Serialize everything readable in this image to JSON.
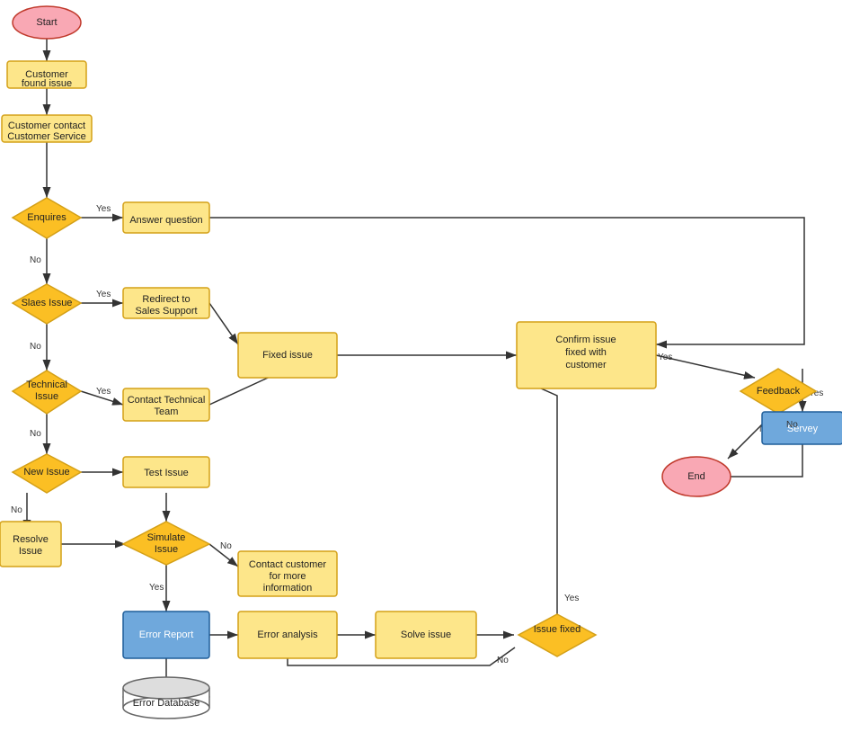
{
  "nodes": {
    "start": "Start",
    "customerFoundIssue": "Customer found issue",
    "customerContactCS": "Customer contact Customer Service",
    "enquires": "Enquires",
    "answerQuestion": "Answer question",
    "slaesIssue": "Slaes Issue",
    "redirectSales": "Redirect to Sales Support",
    "fixedIssue": "Fixed issue",
    "technicalIssue": "Technical Issue",
    "contactTechnical": "Contact Technical Team",
    "newIssue": "New Issue",
    "testIssue": "Test Issue",
    "resolveIssue": "Resolve Issue",
    "simulateIssue": "Simulate Issue",
    "contactCustomer": "Contact customer for more information",
    "errorReport": "Error Report",
    "errorDatabase": "Error Database",
    "errorAnalysis": "Error analysis",
    "solveIssue": "Solve issue",
    "issueFixed": "Issue fixed",
    "confirmIssue": "Confirm issue fixed with customer",
    "feedback": "Feedback",
    "servey": "Servey",
    "end": "End"
  }
}
